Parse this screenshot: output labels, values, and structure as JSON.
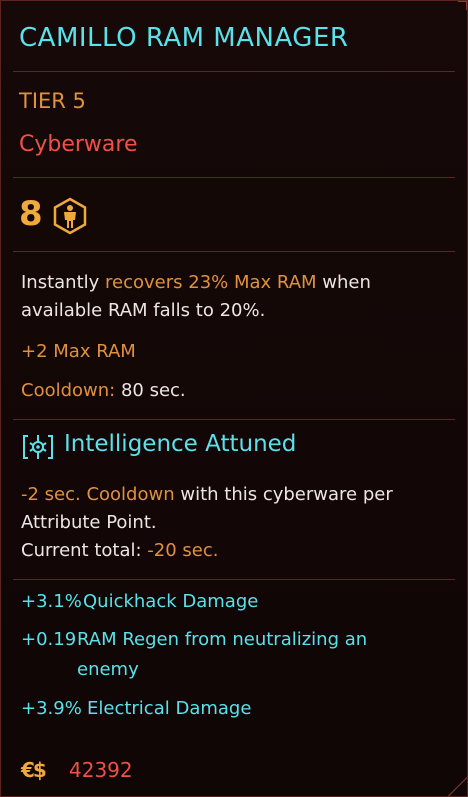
{
  "item": {
    "name": "CAMILLO RAM MANAGER",
    "tier": "TIER 5",
    "type": "Cyberware",
    "capacity": "8",
    "capacity_icon": "humanoid-hexagon-icon",
    "description": {
      "prefix": "Instantly ",
      "highlight": "recovers 23% Max RAM",
      "suffix": " when available RAM falls to 20%."
    },
    "bonus": "+2 Max RAM",
    "cooldown": {
      "label": "Cooldown:",
      "value": " 80 sec."
    }
  },
  "attunement": {
    "icon": "brain-chip-icon",
    "title": "Intelligence Attuned",
    "desc_highlight": "-2 sec. Cooldown",
    "desc_text": " with this cyberware per Attribute Point.",
    "total_label": "Current total: ",
    "total_value": "-20 sec."
  },
  "stats": [
    {
      "value": "+3.1%",
      "text": "Quickhack Damage"
    },
    {
      "value": "+0.19",
      "text": "RAM Regen from neutralizing an enemy"
    },
    {
      "value": "+3.9%",
      "text": "Electrical Damage"
    }
  ],
  "price": {
    "currency_icon": "eurodollar-icon",
    "symbol": "€$",
    "value": "42392"
  },
  "colors": {
    "cyan": "#5ae1ea",
    "orange": "#e0913f",
    "red": "#ee5148",
    "text": "#ece6e3",
    "divider": "#5b2623"
  }
}
